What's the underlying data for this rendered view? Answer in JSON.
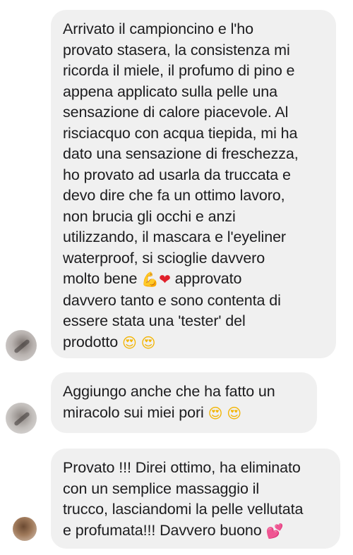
{
  "messages": [
    {
      "lines": [
        "Arrivato il campioncino e l'ho",
        "provato stasera, la consistenza mi",
        "ricorda il miele, il profumo di pino e",
        "appena applicato sulla pelle una",
        "sensazione di calore piacevole. Al",
        "risciacquo con acqua tiepida, mi ha",
        "dato una sensazione di freschezza,",
        "ho provato ad usarla da truccata e",
        "devo dire che fa un ottimo lavoro,",
        "non brucia gli occhi e anzi",
        "utilizzando, il mascara e l'eyeliner",
        "waterproof, si scioglie davvero"
      ],
      "line_with_emoji": {
        "before": "molto bene ",
        "emoji_1": "💪",
        "emoji_2": "❤",
        "after": " approvato"
      },
      "lines_after": [
        "davvero tanto e sono contenta di",
        "essere stata una 'tester' del"
      ],
      "last_line": {
        "text": "prodotto ",
        "emoji_1": "😍",
        "emoji_2": "😍"
      }
    },
    {
      "lines": [
        "Aggiungo anche che ha fatto un"
      ],
      "last_line": {
        "text": "miracolo sui miei pori ",
        "emoji_1": "😍",
        "emoji_2": "😍"
      }
    },
    {
      "lines": [
        "Provato !!! Direi ottimo, ha eliminato",
        "con un semplice massaggio il",
        "trucco, lasciandomi la pelle vellutata"
      ],
      "last_line": {
        "text": "e profumata!!! Davvero buono ",
        "emoji_1": "💕"
      }
    }
  ],
  "colors": {
    "bubble_background": "#f0f0f0",
    "text": "#1c1c1e",
    "page_background": "#ffffff"
  },
  "icons": {
    "avatar_1": "sender-avatar",
    "avatar_2": "sender-avatar",
    "avatar_3": "sender-avatar"
  }
}
